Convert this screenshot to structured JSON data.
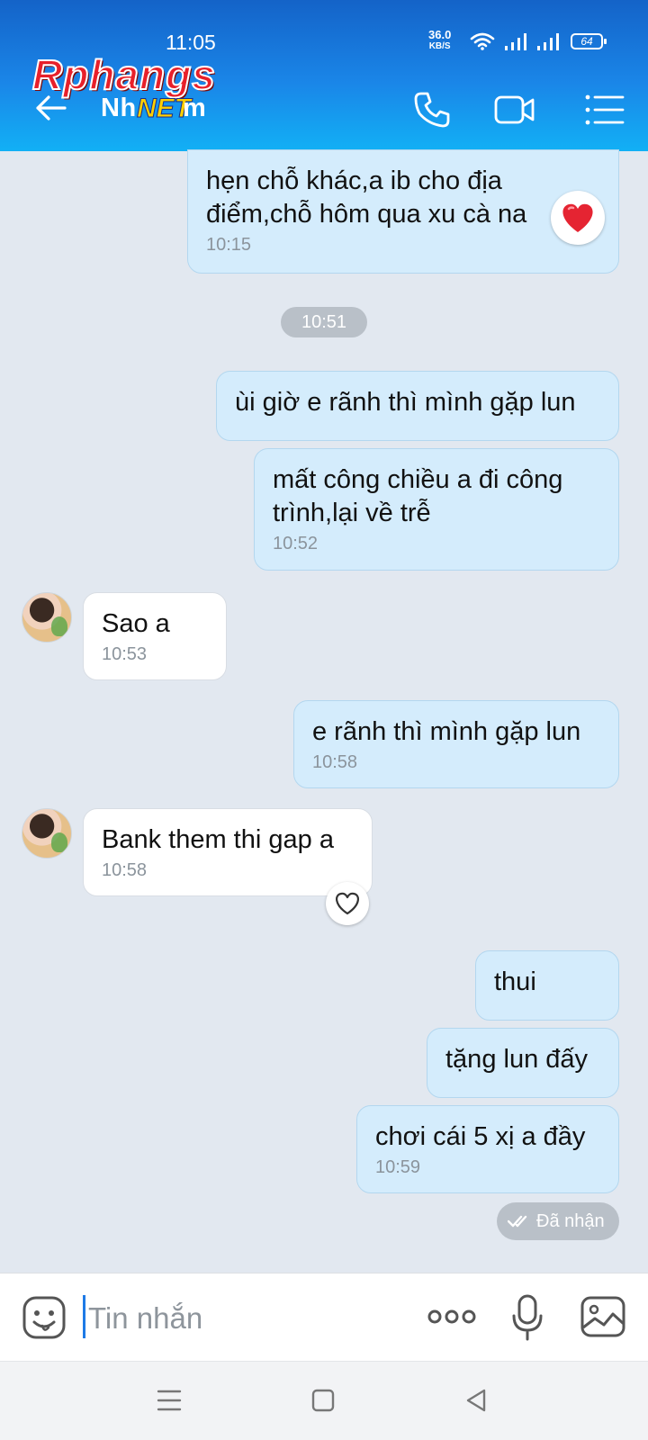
{
  "status_bar": {
    "time": "11:05",
    "net_speed": "36.0",
    "net_unit": "KB/S",
    "battery": "64"
  },
  "watermark": {
    "line1": "Rphangs",
    "line2": "NET"
  },
  "header": {
    "contact_name": "Nh      m",
    "icons": [
      "back-arrow-icon",
      "phone-icon",
      "video-camera-icon",
      "list-menu-icon"
    ]
  },
  "chat": {
    "time_divider": "10:51",
    "messages": [
      {
        "dir": "out",
        "text": "hẹn chỗ khác,a ib cho địa điểm,chỗ hôm qua xu cà na",
        "time": "10:15",
        "reaction": "heart-red"
      },
      {
        "dir": "out",
        "text": "ùi giờ e rãnh thì mình gặp lun",
        "time": ""
      },
      {
        "dir": "out",
        "text": "mất công chiều a đi công trình,lại về trễ",
        "time": "10:52"
      },
      {
        "dir": "in",
        "text": "Sao a",
        "time": "10:53"
      },
      {
        "dir": "out",
        "text": "e rãnh thì mình gặp lun",
        "time": "10:58"
      },
      {
        "dir": "in",
        "text": "Bank them thi gap a",
        "time": "10:58",
        "reaction": "heart-outline"
      },
      {
        "dir": "out",
        "text": "thui",
        "time": ""
      },
      {
        "dir": "out",
        "text": "tặng lun đấy",
        "time": ""
      },
      {
        "dir": "out",
        "text": "chơi cái 5 xị a đầy",
        "time": "10:59"
      }
    ],
    "delivery_status": "Đã nhận"
  },
  "composer": {
    "placeholder": "Tin nhắn",
    "icons": [
      "sticker-icon",
      "more-icon",
      "microphone-icon",
      "photo-icon"
    ]
  },
  "system_nav": [
    "recents-icon",
    "home-icon",
    "back-icon"
  ],
  "colors": {
    "header_top": "#1463c8",
    "header_bottom": "#12b0f5",
    "outgoing_bubble": "#d4ecfc",
    "incoming_bubble": "#ffffff",
    "chat_background": "#e2e8f0",
    "accent": "#1e7ae6"
  }
}
